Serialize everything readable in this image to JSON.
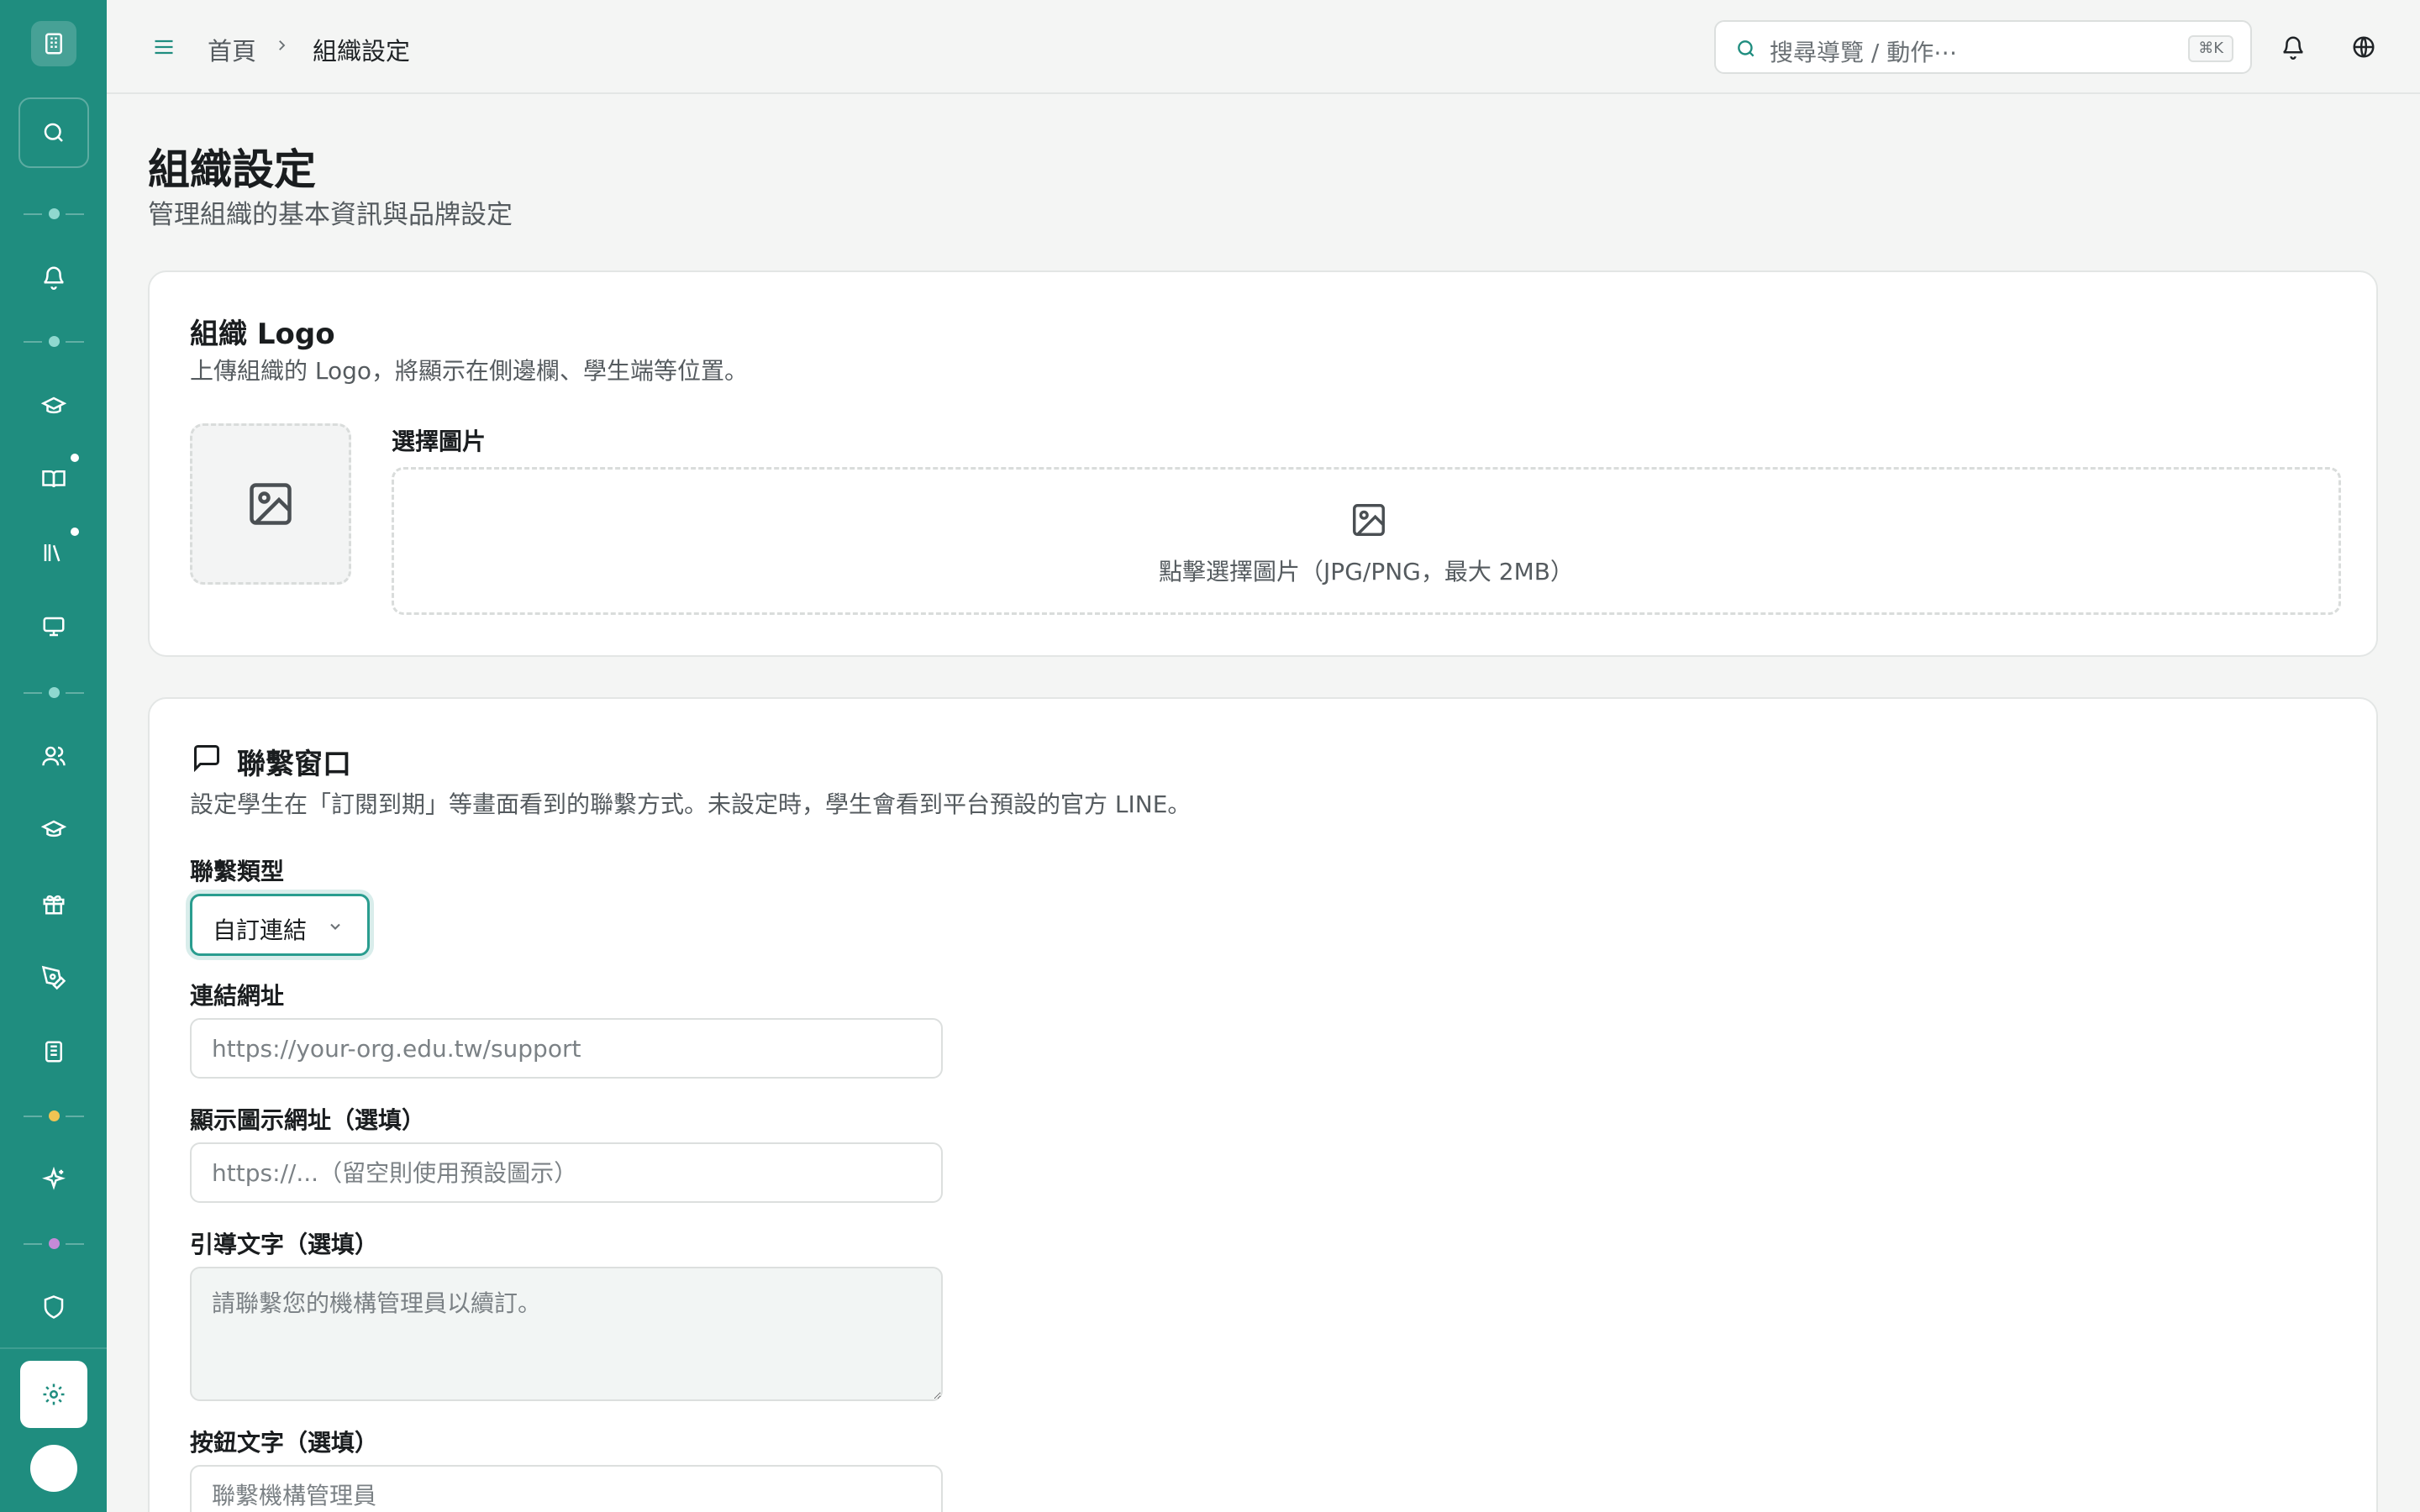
{
  "header": {
    "breadcrumb_home": "首頁",
    "breadcrumb_current": "組織設定",
    "search_placeholder": "搜尋導覽 / 動作⋯",
    "search_shortcut": "⌘K"
  },
  "page": {
    "title": "組織設定",
    "subtitle": "管理組織的基本資訊與品牌設定"
  },
  "logo_card": {
    "title": "組織 Logo",
    "description": "上傳組織的 Logo，將顯示在側邊欄、學生端等位置。",
    "pick_label": "選擇圖片",
    "dropzone_text": "點擊選擇圖片（JPG/PNG，最大 2MB）"
  },
  "contact_card": {
    "title": "聯繫窗口",
    "description": "設定學生在「訂閱到期」等畫面看到的聯繫方式。未設定時，學生會看到平台預設的官方 LINE。",
    "type_label": "聯繫類型",
    "type_value": "自訂連結",
    "url_label": "連結網址",
    "url_placeholder": "https://your-org.edu.tw/support",
    "icon_url_label": "顯示圖示網址（選填）",
    "icon_url_placeholder": "https://...（留空則使用預設圖示）",
    "guide_label": "引導文字（選填）",
    "guide_placeholder": "請聯繫您的機構管理員以續訂。",
    "button_label": "按鈕文字（選填）",
    "button_placeholder": "聯繫機構管理員"
  },
  "sidebar": {
    "icons": [
      "building-icon",
      "search-icon",
      "bell-icon",
      "graduation-cap-icon",
      "book-icon",
      "library-icon",
      "monitor-icon",
      "users-icon",
      "graduation-cap-icon",
      "gift-icon",
      "pen-tool-icon",
      "badge-icon",
      "sparkles-icon",
      "shield-icon",
      "gear-icon"
    ]
  },
  "colors": {
    "sidebar": "#1f8d7f",
    "accent": "#2a9d8f",
    "background": "#f4f5f4",
    "dot_teal": "#8fd8cf",
    "dot_yellow": "#f1c453",
    "dot_purple": "#c58ad8"
  }
}
